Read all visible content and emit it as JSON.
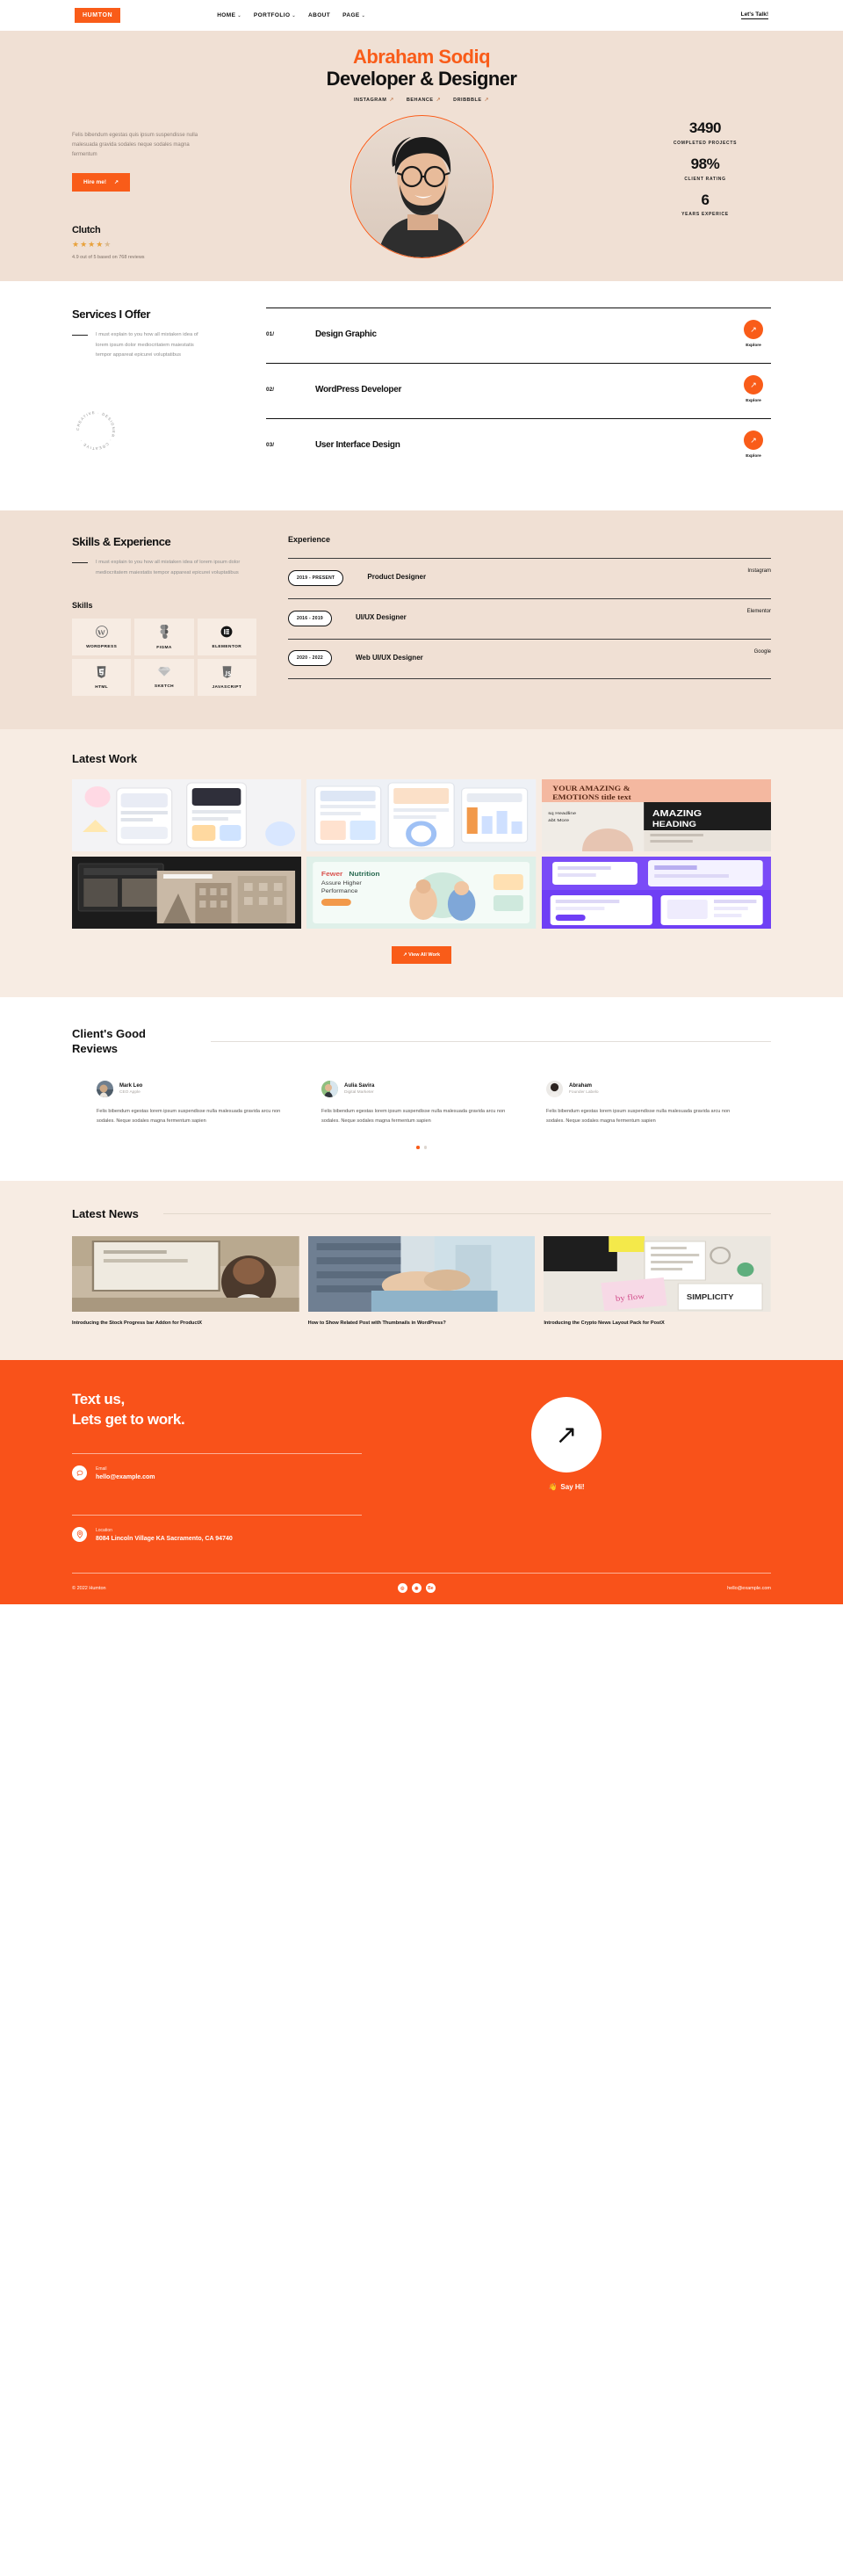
{
  "brand": {
    "logo": "HUMTON",
    "accent": "#f95c19",
    "hero_bg": "#f0e0d4",
    "cream_bg": "#f7ece3"
  },
  "header": {
    "nav": [
      {
        "label": "HOME",
        "caret": "⌄"
      },
      {
        "label": "PORTFOLIO",
        "caret": "⌄"
      },
      {
        "label": "ABOUT",
        "caret": ""
      },
      {
        "label": "PAGE",
        "caret": "⌄"
      }
    ],
    "cta": "Let's Talk!"
  },
  "hero": {
    "name": "Abraham Sodiq",
    "role": "Developer & Designer",
    "socials": [
      {
        "label": "INSTAGRAM",
        "arrow": "↗"
      },
      {
        "label": "BEHANCE",
        "arrow": "↗"
      },
      {
        "label": "DRIBBBLE",
        "arrow": "↗"
      }
    ],
    "description": "Felis bibendum egestas quis ipsum suspendisse nulla malesuada gravida sodales neque sodales magna fermentum",
    "button": "Hire me!",
    "button_arrow": "↗",
    "stats": [
      {
        "value": "3490",
        "label": "COMPLETED PROJECTS"
      },
      {
        "value": "98%",
        "label": "CLIENT RATING"
      },
      {
        "value": "6",
        "label": "YEARS EXPERICE"
      }
    ],
    "clutch": {
      "name": "Clutch",
      "stars": "★★★★",
      "half_star": "★",
      "caption": "4.9 out of 5 based on 768 reviews"
    }
  },
  "services": {
    "title": "Services I Offer",
    "subtitle": "I must explain to you how all mistaken idea of lorem ipsum dolor mediocritatem maiestatis tempor appareat epicurei voluptatibus",
    "badge_text": "CREATIVE · DESIGNER · ",
    "items": [
      {
        "num": "01/",
        "title": "Design Graphic",
        "cta": "Explore",
        "arrow": "↗"
      },
      {
        "num": "02/",
        "title": "WordPress Developer",
        "cta": "Explore",
        "arrow": "↗"
      },
      {
        "num": "03/",
        "title": "User Interface Design",
        "cta": "Explore",
        "arrow": "↗"
      }
    ]
  },
  "skills_section": {
    "title": "Skills & Experience",
    "subtitle": "I must explain to you how all mistaken idea of lorem ipsum dolor mediocritatem maiestatis tempor appareat epicurei voluptatibus",
    "skills_heading": "Skills",
    "skills": [
      {
        "name": "WORDPRESS",
        "icon": "wordpress-icon",
        "glyph": "Ⓦ"
      },
      {
        "name": "FIGMA",
        "icon": "figma-icon",
        "glyph": "🄵"
      },
      {
        "name": "ELEMENTOR",
        "icon": "elementor-icon",
        "glyph": "🄴"
      },
      {
        "name": "HTML",
        "icon": "html5-icon",
        "glyph": "🯅"
      },
      {
        "name": "SKETCH",
        "icon": "sketch-icon",
        "glyph": "◈"
      },
      {
        "name": "JAVASCRIPT",
        "icon": "javascript-icon",
        "glyph": "🄹"
      }
    ],
    "experience_heading": "Experience",
    "experience": [
      {
        "period": "2019 - PRESENT",
        "role": "Product Designer",
        "company": "Instagram"
      },
      {
        "period": "2016 - 2019",
        "role": "UI/UX Designer",
        "company": "Elementor"
      },
      {
        "period": "2020 - 2022",
        "role": "Web UI/UX Designer",
        "company": "Google"
      }
    ]
  },
  "work": {
    "title": "Latest Work",
    "button": "View All Work",
    "button_arrow": "↗",
    "tiles": [
      {
        "name": "mobile-app-mockups"
      },
      {
        "name": "dashboard-ui-kit"
      },
      {
        "name": "editorial-typography"
      },
      {
        "name": "architecture-website"
      },
      {
        "name": "fitness-landing-page"
      },
      {
        "name": "purple-saas-ui"
      }
    ]
  },
  "reviews": {
    "title": "Client's Good Reviews",
    "items": [
      {
        "name": "Mark Leo",
        "role": "CEO Apple",
        "text": "Felis bibendum egestas lorem ipsum suspendisse nulla malesuada gravida arcu non sodales. Neque sodales magna fermentum sapien"
      },
      {
        "name": "Aulia Savira",
        "role": "Digital Marketer",
        "text": "Felis bibendum egestas lorem ipsum suspendisse nulla malesuada gravida arcu non sodales. Neque sodales magna fermentum sapien"
      },
      {
        "name": "Abraham",
        "role": "Founder Labelo",
        "text": "Felis bibendum egestas lorem ipsum suspendisse nulla malesuada gravida arcu non sodales. Neque sodales magna fermentum sapien"
      }
    ],
    "dots": 2,
    "active_dot": 0
  },
  "news": {
    "title": "Latest News",
    "items": [
      {
        "caption": "Introducing the Stock Progress bar Addon for ProductX",
        "image": "meeting-whiteboard-photo"
      },
      {
        "caption": "How to Show Related Post with Thumbnails in WordPress?",
        "image": "handshake-office-photo"
      },
      {
        "caption": "Introducing the Crypto News Layout Pack for PostX",
        "image": "desk-charts-photo"
      }
    ]
  },
  "cta": {
    "line1": "Text us,",
    "line2": "Lets get to work.",
    "email_label": "Email",
    "email_value": "hello@example.com",
    "location_label": "Location",
    "location_value": "8084 Lincoln Village KA Sacramento, CA 94740",
    "circle_arrow": "↗",
    "say_hi": "Say Hi!",
    "wave": "👋"
  },
  "footer": {
    "copyright": "© 2022 Humton",
    "socials": [
      {
        "name": "instagram-icon",
        "glyph": "◎"
      },
      {
        "name": "dribbble-icon",
        "glyph": "◉"
      },
      {
        "name": "behance-icon",
        "glyph": "Be"
      }
    ],
    "email": "hello@example.com"
  }
}
